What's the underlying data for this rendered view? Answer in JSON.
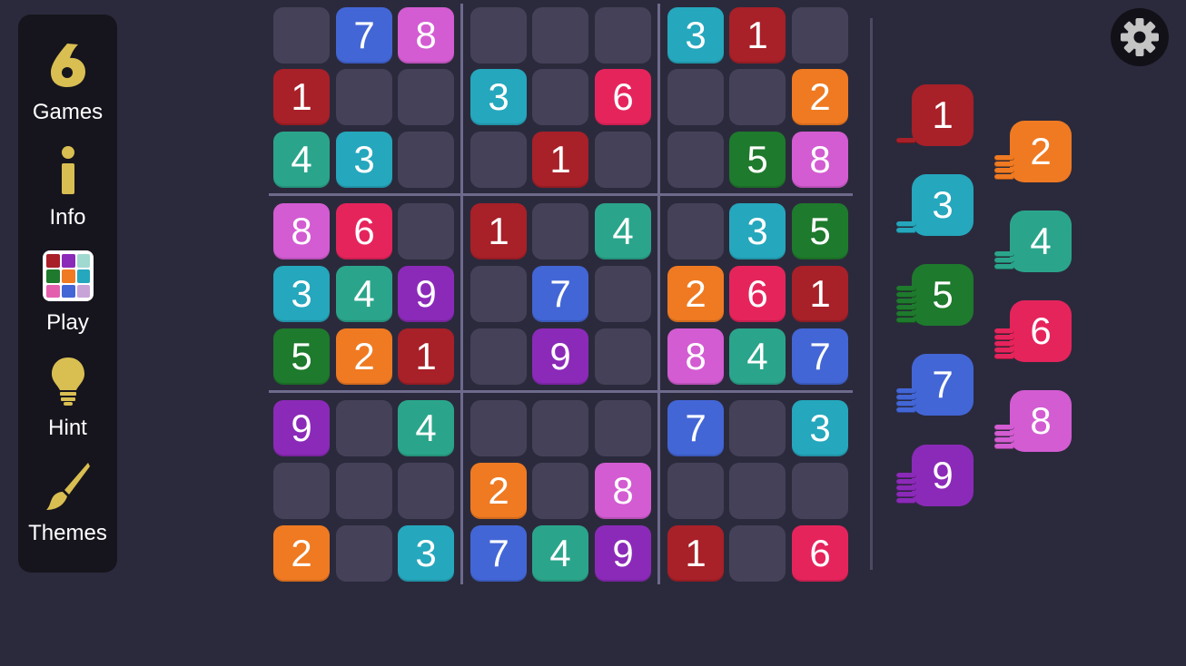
{
  "colors": {
    "background": "#2b2a3c",
    "sidebar_bg": "#16151d",
    "empty_cell": "#454159",
    "gold_icon": "#d9be52",
    "numbers": {
      "1": "#a82028",
      "2": "#ef7a22",
      "3": "#25a7bd",
      "4": "#2aa58b",
      "5": "#1e7a2c",
      "6": "#e6245c",
      "7": "#4366d6",
      "8": "#d35cd2",
      "9": "#8b2ab8"
    }
  },
  "sidebar": {
    "items": [
      {
        "id": "games",
        "label": "Games",
        "icon": "games-logo-icon"
      },
      {
        "id": "info",
        "label": "Info",
        "icon": "info-icon"
      },
      {
        "id": "play",
        "label": "Play",
        "icon": "color-grid-icon"
      },
      {
        "id": "hint",
        "label": "Hint",
        "icon": "lightbulb-icon"
      },
      {
        "id": "themes",
        "label": "Themes",
        "icon": "paintbrush-icon"
      }
    ]
  },
  "board": {
    "rows": [
      [
        "",
        "7",
        "8",
        "",
        "",
        "",
        "3",
        "1",
        ""
      ],
      [
        "1",
        "",
        "",
        "3",
        "",
        "6",
        "",
        "",
        "2"
      ],
      [
        "4",
        "3",
        "",
        "",
        "1",
        "",
        "",
        "5",
        "8"
      ],
      [
        "8",
        "6",
        "",
        "1",
        "",
        "4",
        "",
        "3",
        "5"
      ],
      [
        "3",
        "4",
        "9",
        "",
        "7",
        "",
        "2",
        "6",
        "1"
      ],
      [
        "5",
        "2",
        "1",
        "",
        "9",
        "",
        "8",
        "4",
        "7"
      ],
      [
        "9",
        "",
        "4",
        "",
        "",
        "",
        "7",
        "",
        "3"
      ],
      [
        "",
        "",
        "",
        "2",
        "",
        "8",
        "",
        "",
        ""
      ],
      [
        "2",
        "",
        "3",
        "7",
        "4",
        "9",
        "1",
        "",
        "6"
      ]
    ]
  },
  "palette": {
    "numbers": [
      {
        "value": "1",
        "coins": 1
      },
      {
        "value": "2",
        "coins": 4
      },
      {
        "value": "3",
        "coins": 2
      },
      {
        "value": "4",
        "coins": 3
      },
      {
        "value": "5",
        "coins": 6
      },
      {
        "value": "6",
        "coins": 5
      },
      {
        "value": "7",
        "coins": 4
      },
      {
        "value": "8",
        "coins": 4
      },
      {
        "value": "9",
        "coins": 5
      }
    ]
  },
  "settings": {
    "icon": "gear-icon"
  }
}
